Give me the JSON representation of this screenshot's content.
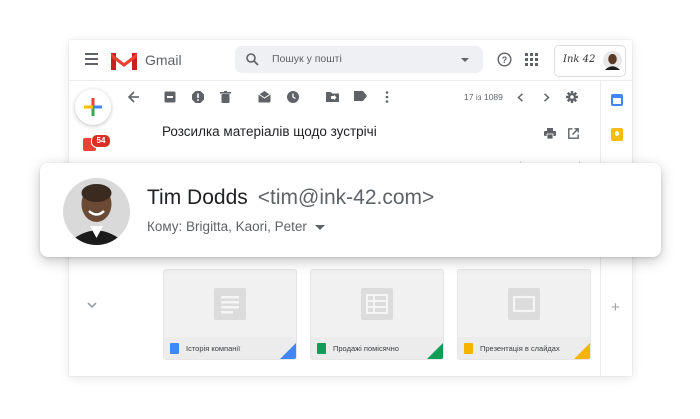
{
  "app": {
    "brand": "Gmail",
    "accent_colors": {
      "red": "#ea4335",
      "blue": "#4285f4",
      "green": "#34a853",
      "yellow": "#fbbc04"
    }
  },
  "header": {
    "search_placeholder": "Пошук у пошті",
    "account_brand": "Ink 42",
    "icons": [
      "menu-icon",
      "gmail-logo",
      "search-icon",
      "help-icon",
      "apps-icon",
      "avatar"
    ]
  },
  "sidebar": {
    "meet_badge_count": "54",
    "icons": [
      "compose-icon",
      "meet-icon",
      "chevron-down-icon"
    ]
  },
  "toolbar": {
    "icons": [
      "back-arrow-icon",
      "archive-icon",
      "report-spam-icon",
      "delete-icon",
      "mark-unread-icon",
      "snooze-icon",
      "move-to-icon",
      "label-icon",
      "more-vert-icon",
      "chevron-left-icon",
      "chevron-right-icon",
      "settings-icon"
    ],
    "pager": "17 із 1089"
  },
  "message": {
    "subject": "Розсилка матеріалів щодо зустрічі",
    "sender_name": "Tim Dodds",
    "sender_email": "<tim@ink-42.com>",
    "recipients": "Кому: Brigitta, Kaori, Peter"
  },
  "attachments": [
    {
      "name": "Історія компанії",
      "type": "docs",
      "color": "#4285f4"
    },
    {
      "name": "Продажі помісячно",
      "type": "sheets",
      "color": "#0f9d58"
    },
    {
      "name": "Презентація в слайдах",
      "type": "slides",
      "color": "#f4b400"
    }
  ],
  "right_panel": {
    "icons": [
      "calendar-icon",
      "keep-icon",
      "add-icon"
    ]
  }
}
